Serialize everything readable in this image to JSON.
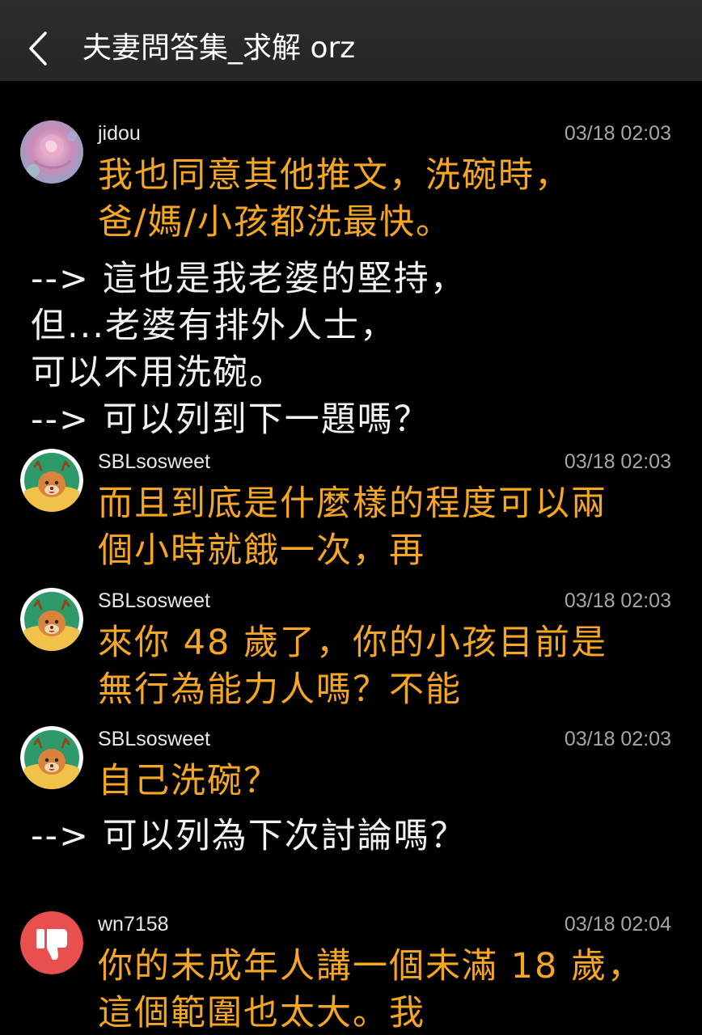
{
  "header": {
    "title": "夫妻問答集_求解 orz",
    "back_icon": "chevron-left-icon"
  },
  "colors": {
    "background": "#000000",
    "header_bg": "#2a2a2a",
    "push_text": "#f5a623",
    "note_text": "#f2f2f2",
    "time_text": "#a6a6a6"
  },
  "comments": [
    {
      "author": "jidou",
      "time": "03/18 02:03",
      "avatar": "rose-avatar",
      "lines": [
        "我也同意其他推文，洗碗時，",
        "爸/媽/小孩都洗最快。"
      ]
    },
    {
      "author": "SBLsosweet",
      "time": "03/18 02:03",
      "avatar": "deer-avatar",
      "lines": [
        "而且到底是什麼樣的程度可以兩",
        "個小時就餓一次，再"
      ]
    },
    {
      "author": "SBLsosweet",
      "time": "03/18 02:03",
      "avatar": "deer-avatar",
      "lines": [
        "來你 48 歲了，你的小孩目前是",
        "無行為能力人嗎？不能"
      ]
    },
    {
      "author": "SBLsosweet",
      "time": "03/18 02:03",
      "avatar": "deer-avatar",
      "lines": [
        "自己洗碗？"
      ]
    },
    {
      "author": "wn7158",
      "time": "03/18 02:04",
      "avatar": "thumbs-down-avatar",
      "lines": [
        "你的未成年人講一個未滿 18 歲，",
        "這個範圍也太大。我"
      ]
    }
  ],
  "notes": [
    {
      "lines": [
        "--> 這也是我老婆的堅持，",
        "但...老婆有排外人士，",
        "可以不用洗碗。",
        "--> 可以列到下一題嗎？"
      ]
    },
    {
      "lines": [
        "--> 可以列為下次討論嗎？"
      ]
    }
  ]
}
